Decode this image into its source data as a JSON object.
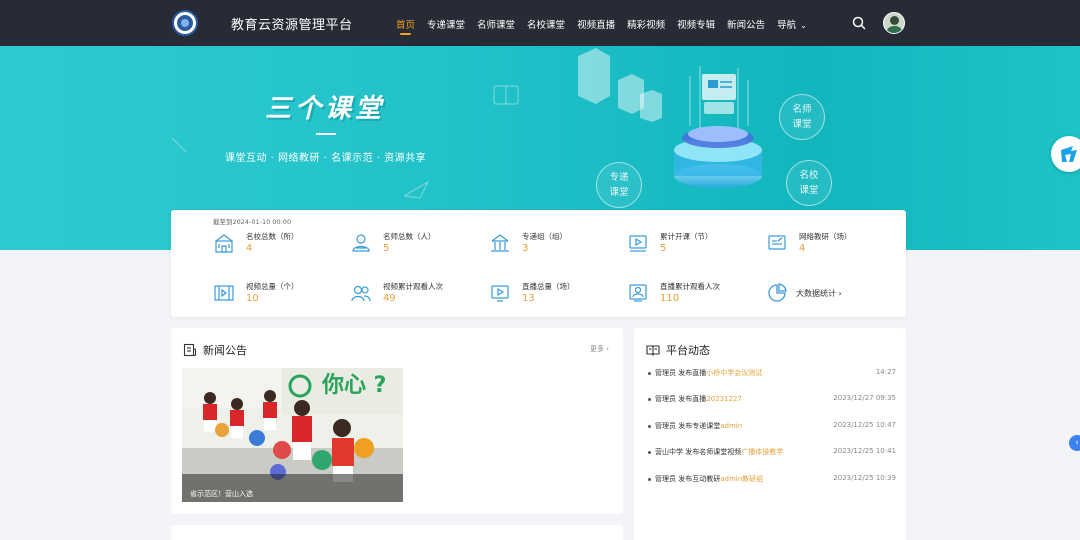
{
  "header": {
    "site_title": "教育云资源管理平台",
    "nav": [
      {
        "label": "首页",
        "active": true
      },
      {
        "label": "专递课堂"
      },
      {
        "label": "名师课堂"
      },
      {
        "label": "名校课堂"
      },
      {
        "label": "视频直播"
      },
      {
        "label": "精彩视频"
      },
      {
        "label": "视频专辑"
      },
      {
        "label": "新闻公告"
      },
      {
        "label": "导航"
      }
    ],
    "icons": [
      "logo",
      "chevron-down-icon",
      "search-icon",
      "avatar"
    ]
  },
  "banner": {
    "title": "三个课堂",
    "subtitle": "课堂互动 · 网络教研 · 名课示范 · 资源共享",
    "bubble_1_line1": "名师",
    "bubble_1_line2": "课堂",
    "bubble_2_line1": "专递",
    "bubble_2_line2": "课堂",
    "bubble_3_line1": "名校",
    "bubble_3_line2": "课堂",
    "bg_gradient": [
      "#2fcad0",
      "#13b6be"
    ]
  },
  "stats": {
    "date_note": "截至到2024-01-10 00:00",
    "items": [
      {
        "label": "名校总数（所）",
        "value": "4",
        "icon": "school-icon"
      },
      {
        "label": "名师总数（人）",
        "value": "5",
        "icon": "teacher-icon"
      },
      {
        "label": "专递组（组）",
        "value": "3",
        "icon": "classroom-icon"
      },
      {
        "label": "累计开课（节）",
        "value": "5",
        "icon": "video-lesson-icon"
      },
      {
        "label": "网络教研（场）",
        "value": "4",
        "icon": "research-icon"
      },
      {
        "label": "视频总量（个）",
        "value": "10",
        "icon": "film-icon"
      },
      {
        "label": "视频累计观看人次",
        "value": "49",
        "icon": "viewers-icon"
      },
      {
        "label": "直播总量（场）",
        "value": "13",
        "icon": "live-icon"
      },
      {
        "label": "直播累计观看人次",
        "value": "110",
        "icon": "live-viewers-icon"
      },
      {
        "label": "大数据统计 ›",
        "value": "",
        "icon": "pie-chart-icon"
      }
    ],
    "value_color": "#e6a23c"
  },
  "news": {
    "title": "新闻公告",
    "more": "更多 ›",
    "photo_caption": "省示范区！营山入选",
    "photo_sign": "你心 ?"
  },
  "dynamics": {
    "title": "平台动态",
    "items": [
      {
        "prefix": "管理员 发布直播",
        "highlight": "小桥中学会议测试",
        "time": "14:27"
      },
      {
        "prefix": "管理员 发布直播",
        "highlight": "20231227",
        "time": "2023/12/27 09:35"
      },
      {
        "prefix": "管理员 发布专递课堂",
        "highlight": "admin",
        "time": "2023/12/25 10:47"
      },
      {
        "prefix": "营山中学 发布名师课堂视频",
        "highlight": "广播体操教学",
        "time": "2023/12/25 10:41"
      },
      {
        "prefix": "管理员 发布互动教研",
        "highlight": "admin教研组",
        "time": "2023/12/25 10:39"
      }
    ]
  }
}
